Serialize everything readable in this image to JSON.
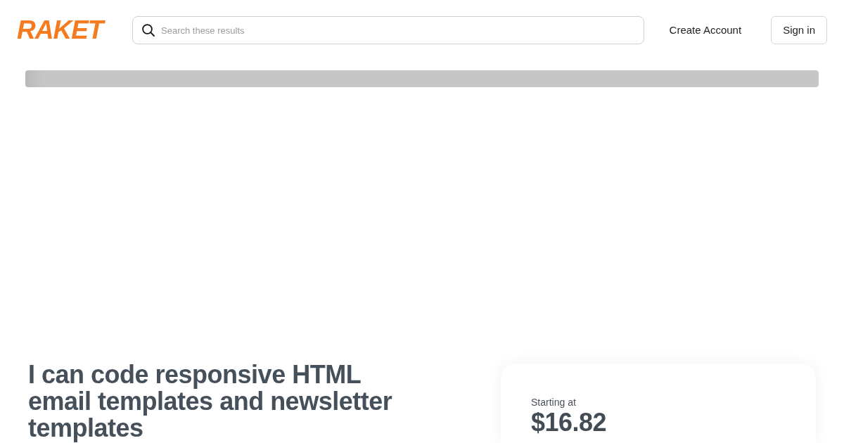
{
  "header": {
    "logo": "RAKET",
    "search": {
      "placeholder": "Search these results"
    },
    "actions": [
      {
        "kind": "link",
        "label": "Create Account"
      },
      {
        "kind": "button",
        "label": "Sign in"
      }
    ]
  },
  "title": "I can code responsive HTML email templates and newsletter templates",
  "price_card": {
    "label": "Starting at",
    "price": "$16.82"
  }
}
